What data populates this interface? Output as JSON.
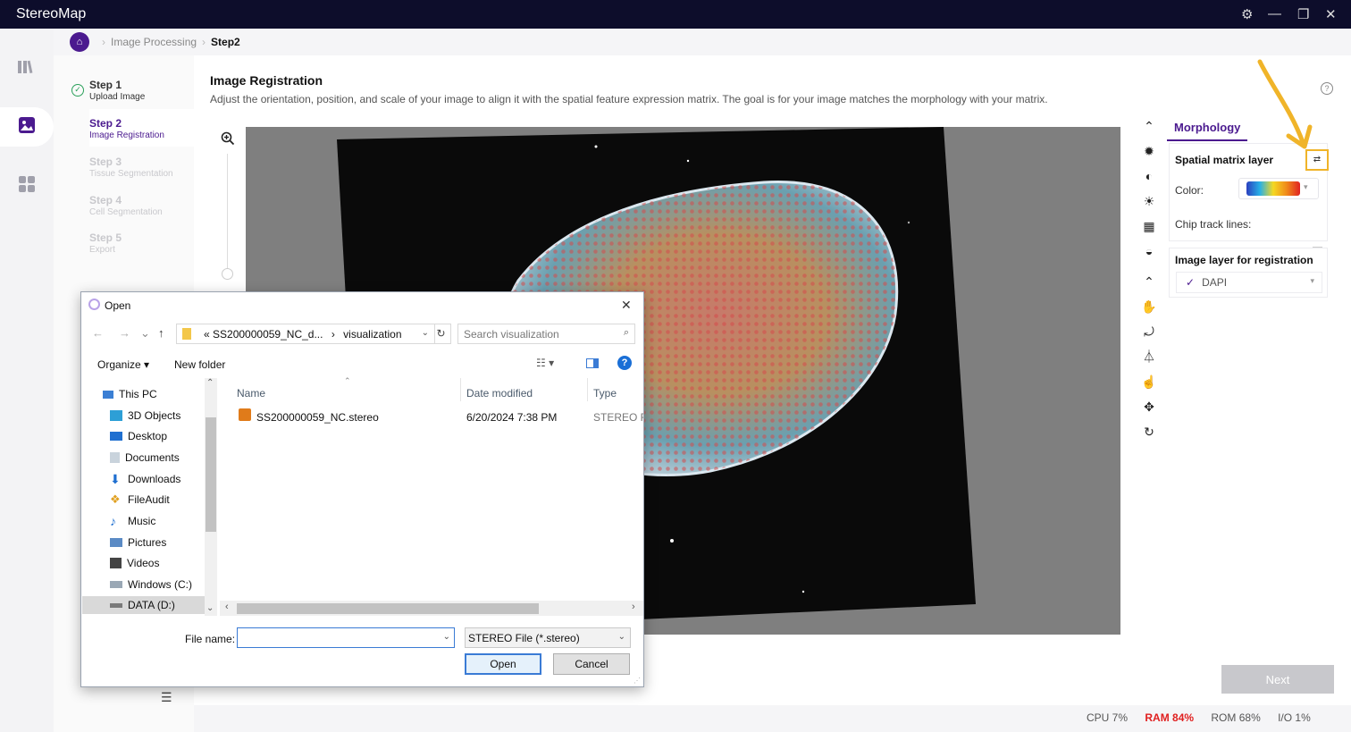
{
  "app": {
    "title": "StereoMap",
    "window_controls": [
      "⚙",
      "—",
      "❐",
      "✕"
    ]
  },
  "breadcrumb": {
    "items": [
      "Image Processing",
      "Step2"
    ]
  },
  "steps": [
    {
      "title": "Step 1",
      "subtitle": "Upload Image",
      "state": "done"
    },
    {
      "title": "Step 2",
      "subtitle": "Image Registration",
      "state": "current"
    },
    {
      "title": "Step 3",
      "subtitle": "Tissue Segmentation",
      "state": "future"
    },
    {
      "title": "Step 4",
      "subtitle": "Cell Segmentation",
      "state": "future"
    },
    {
      "title": "Step 5",
      "subtitle": "Export",
      "state": "future"
    }
  ],
  "main": {
    "title": "Image Registration",
    "description": "Adjust the orientation, position, and scale of your image to align it with the spatial feature expression matrix. The goal is for your image matches the morphology with your matrix."
  },
  "right_panel": {
    "tab": "Morphology",
    "spatial_section_title": "Spatial matrix layer",
    "color_label": "Color:",
    "chip_track_label": "Chip track lines:",
    "image_layer_title": "Image layer for registration",
    "image_layer_value": "DAPI",
    "image_layer_check": "✓"
  },
  "next_label": "Next",
  "status": {
    "cpu": "CPU  7%",
    "ram": "RAM  84%",
    "rom": "ROM  68%",
    "io": "I/O  1%"
  },
  "dialog": {
    "title": "Open",
    "path_prefix": "«",
    "path_parent": "SS200000059_NC_d...",
    "path_sep": "›",
    "path_current": "visualization",
    "search_placeholder": "Search visualization",
    "organize": "Organize ▾",
    "new_folder": "New folder",
    "nav_items": [
      "This PC",
      "3D Objects",
      "Desktop",
      "Documents",
      "Downloads",
      "FileAudit",
      "Music",
      "Pictures",
      "Videos",
      "Windows (C:)",
      "DATA (D:)"
    ],
    "columns": {
      "name": "Name",
      "date": "Date modified",
      "type": "Type"
    },
    "files": [
      {
        "name": "SS200000059_NC.stereo",
        "date": "6/20/2024 7:38 PM",
        "type": "STEREO File"
      }
    ],
    "file_name_label": "File name:",
    "file_name_value": "",
    "file_type": "STEREO File (*.stereo)",
    "open_label": "Open",
    "cancel_label": "Cancel"
  },
  "colors": {
    "titlebar": "#0d0d2b",
    "accent": "#4b1a8f",
    "highlight_box": "#f0b429",
    "ram_alert": "#e02020"
  }
}
